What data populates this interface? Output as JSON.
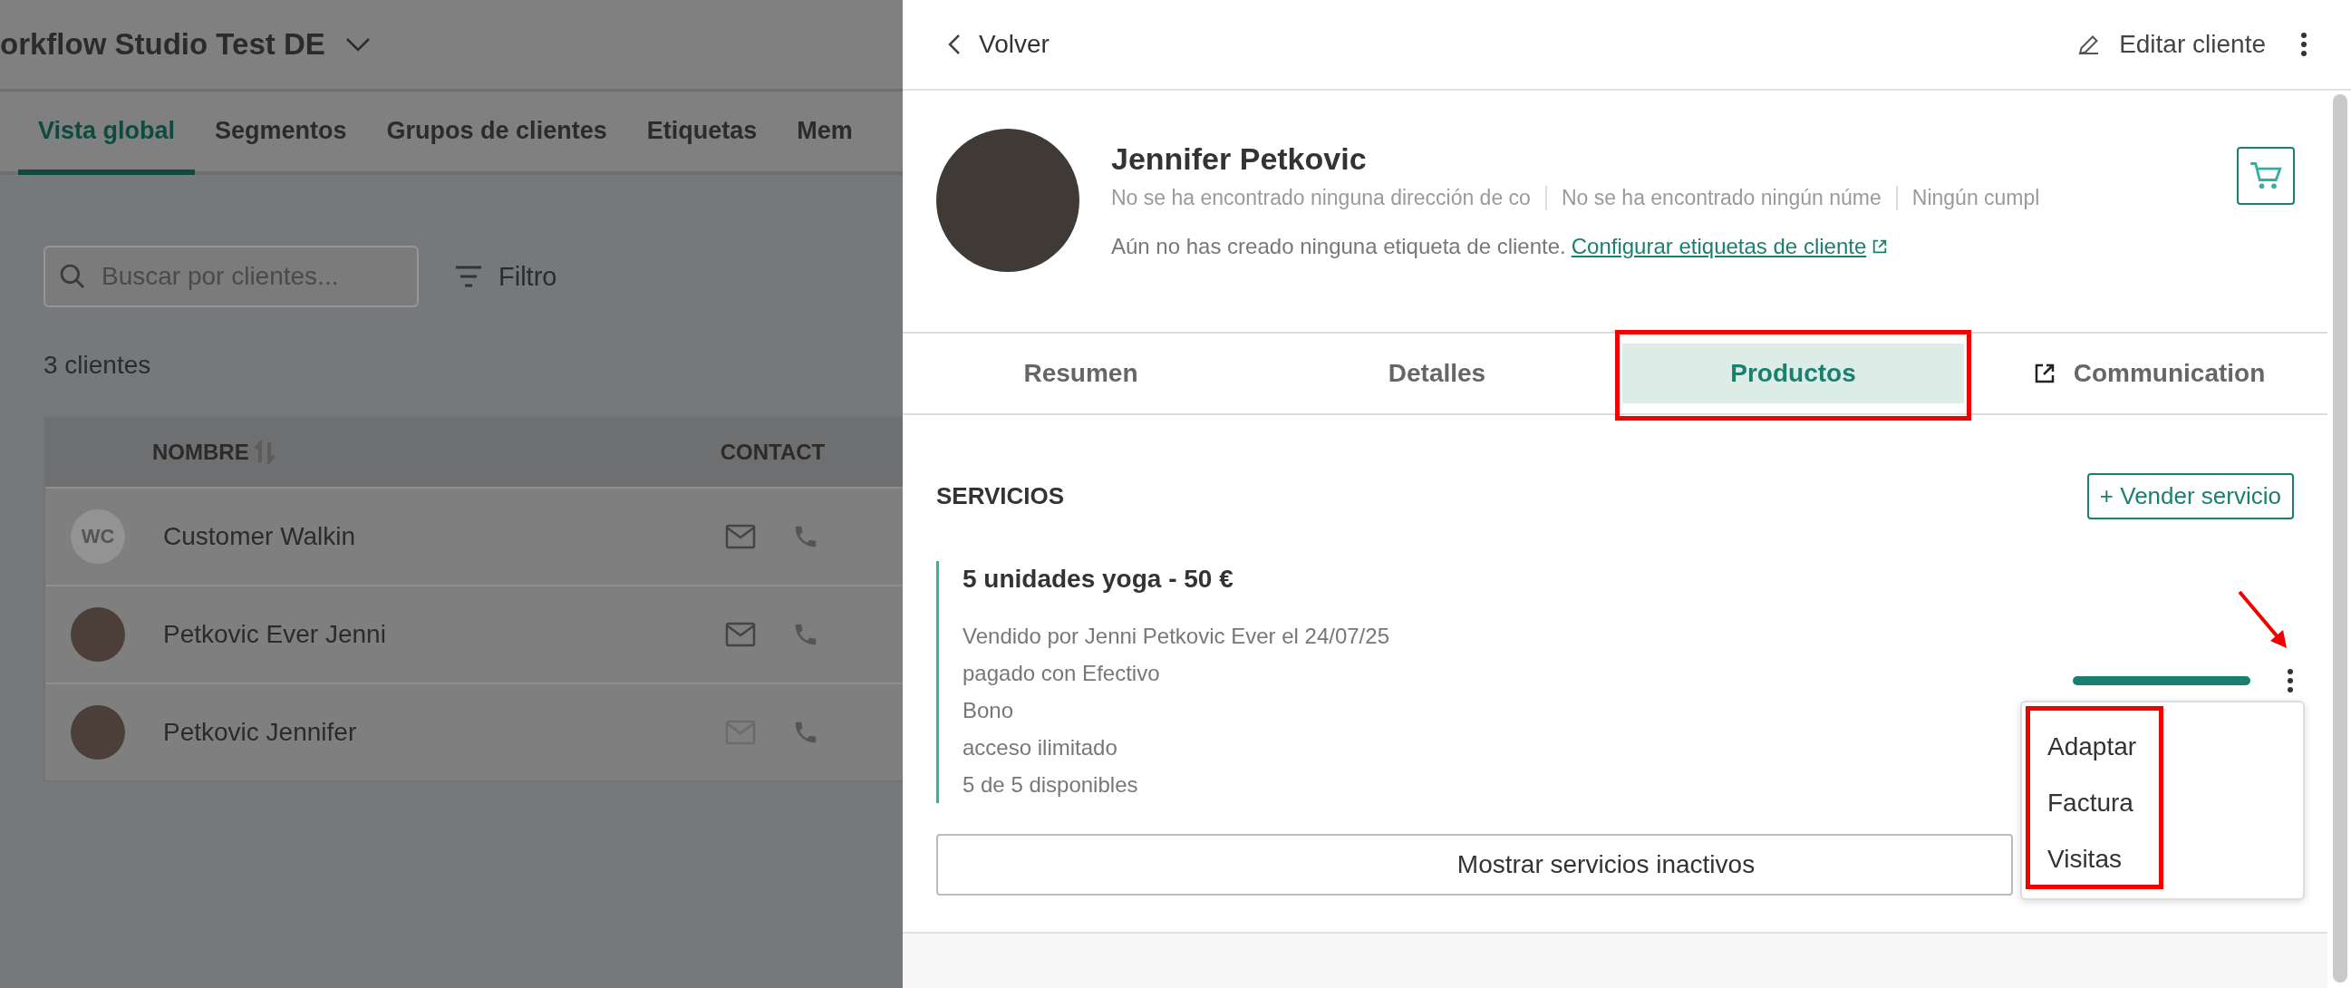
{
  "background": {
    "workspace": {
      "title": "orkflow Studio Test DE"
    },
    "tabs": [
      {
        "label": "Vista global",
        "selected": true
      },
      {
        "label": "Segmentos",
        "selected": false
      },
      {
        "label": "Grupos de clientes",
        "selected": false
      },
      {
        "label": "Etiquetas",
        "selected": false
      },
      {
        "label": "Mem",
        "selected": false
      }
    ],
    "search": {
      "placeholder": "Buscar por clientes..."
    },
    "filter_button": "Filtro",
    "count": "3 clientes",
    "table": {
      "columns": [
        "NOMBRE",
        "CONTACT"
      ],
      "rows": [
        {
          "avatar": {
            "kind": "initials",
            "text": "WC"
          },
          "name": "Customer Walkin",
          "email_available": true
        },
        {
          "avatar": {
            "kind": "photo"
          },
          "name": "Petkovic Ever Jenni",
          "email_available": true
        },
        {
          "avatar": {
            "kind": "photo"
          },
          "name": "Petkovic Jennifer",
          "email_available": false
        }
      ]
    }
  },
  "customer_panel": {
    "back": "Volver",
    "edit": "Editar cliente",
    "name": "Jennifer Petkovic",
    "info": [
      "No se ha encontrado ninguna dirección de co",
      "No se ha encontrado ningún núme",
      "Ningún cumpl"
    ],
    "tags_note": "Aún no has creado ninguna etiqueta de cliente.",
    "tags_link": "Configurar etiquetas de cliente",
    "tabs": [
      {
        "label": "Resumen",
        "selected": false,
        "external": false
      },
      {
        "label": "Detalles",
        "selected": false,
        "external": false
      },
      {
        "label": "Productos",
        "selected": true,
        "external": false
      },
      {
        "label": "Communication",
        "selected": false,
        "external": true
      }
    ],
    "section_title": "SERVICIOS",
    "sell_button": "+ Vender servicio",
    "services": [
      {
        "title": "5 unidades yoga - 50 €",
        "details": [
          "Vendido por Jenni Petkovic Ever el 24/07/25",
          "pagado con Efectivo",
          "Bono",
          "acceso ilimitado",
          "5 de 5 disponibles"
        ],
        "level": 1.0
      }
    ],
    "menu": {
      "items": [
        "Adaptar",
        "Factura",
        "Visitas"
      ]
    },
    "show_inactive": "Mostrar servicios inactivos"
  }
}
